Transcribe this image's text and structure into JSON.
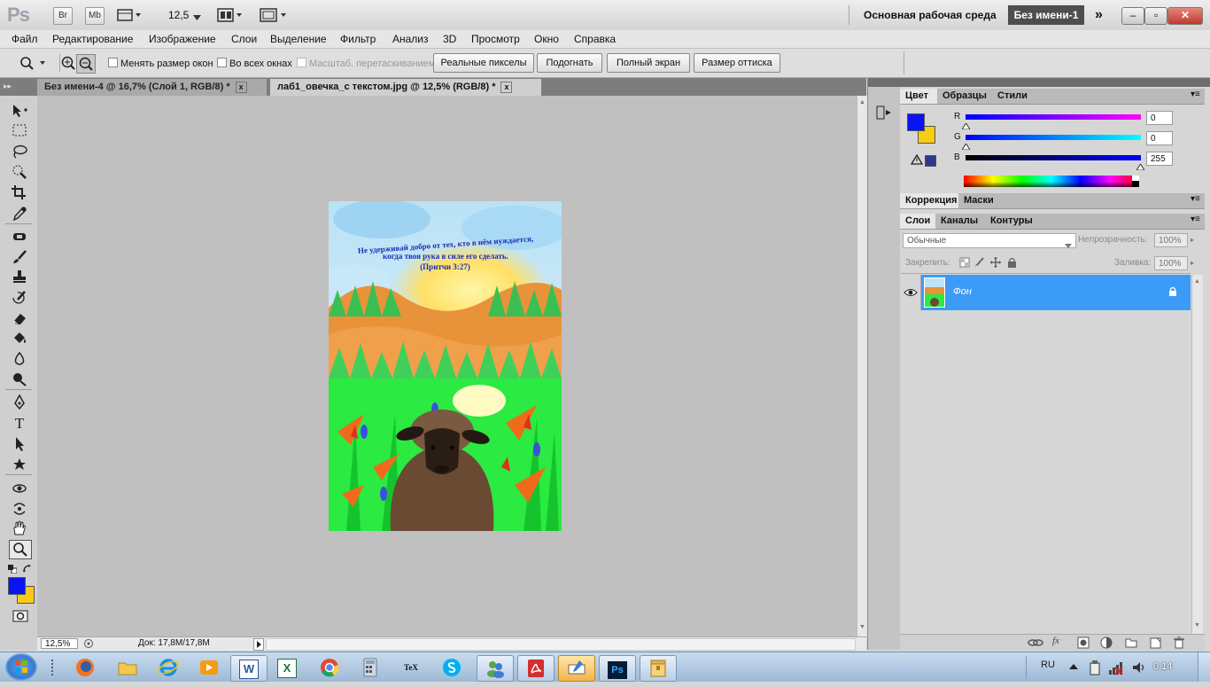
{
  "app": {
    "logo": "Ps",
    "buttons": [
      "Br",
      "Mb"
    ],
    "zoom": "12,5",
    "workspace": "Основная рабочая среда",
    "active_doc": "Без имени-1",
    "more": "»",
    "win_min": "–",
    "win_max": "▫",
    "win_close": "✕"
  },
  "menu": [
    "Файл",
    "Редактирование",
    "Изображение",
    "Слои",
    "Выделение",
    "Фильтр",
    "Анализ",
    "3D",
    "Просмотр",
    "Окно",
    "Справка"
  ],
  "options": {
    "resize_windows": "Менять размер окон",
    "all_windows": "Во всех окнах",
    "scrubby_zoom": "Масштаб. перетаскиванием",
    "actual_pixels": "Реальные пикселы",
    "fit_screen": "Подогнать",
    "fill_screen": "Полный экран",
    "print_size": "Размер оттиска"
  },
  "tabs": [
    {
      "label": "Без имени-4 @ 16,7% (Слой 1, RGB/8) *",
      "close": "x"
    },
    {
      "label": "лаб1_овечка_с текстом.jpg @ 12,5% (RGB/8) *",
      "close": "x"
    }
  ],
  "poster": {
    "line1": "Не удерживай добро от тех, кто в нём нуждается,",
    "line2": "когда твоя рука в силе его сделать.",
    "line3": "(Притчи 3:27)"
  },
  "status": {
    "zoom": "12,5%",
    "doc": "Док: 17,8M/17,8M"
  },
  "colors": {
    "foreground": "#0a14f0",
    "background": "#f6cc16",
    "layer_selected": "#3c9bf6"
  },
  "color_panel": {
    "tabs": [
      "Цвет",
      "Образцы",
      "Стили"
    ],
    "r_label": "R",
    "r_value": "0",
    "g_label": "G",
    "g_value": "0",
    "b_label": "B",
    "b_value": "255"
  },
  "adjust_panel": {
    "tabs": [
      "Коррекция",
      "Маски"
    ]
  },
  "layers_panel": {
    "tabs": [
      "Слои",
      "Каналы",
      "Контуры"
    ],
    "blend_mode": "Обычные",
    "opacity_label": "Непрозрачность:",
    "opacity": "100%",
    "lock_label": "Закрепить:",
    "fill_label": "Заливка:",
    "fill": "100%",
    "layer_name": "Фон"
  },
  "taskbar": {
    "lang": "RU",
    "time": "0:14",
    "apps": [
      "W",
      "X",
      "TeX",
      "Ps"
    ]
  }
}
